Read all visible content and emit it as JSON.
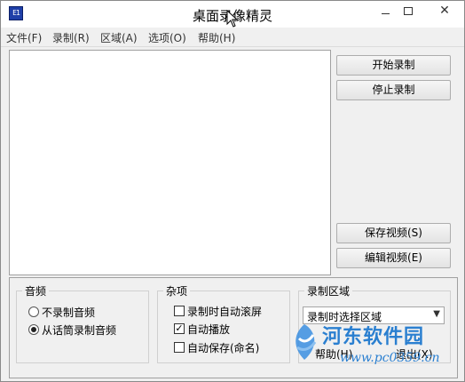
{
  "window": {
    "title": "桌面录像精灵",
    "app_icon_text": "E1"
  },
  "menu": [
    {
      "label": "文件(F)"
    },
    {
      "label": "录制(R)"
    },
    {
      "label": "区域(A)"
    },
    {
      "label": "选项(O)"
    },
    {
      "label": "帮助(H)"
    }
  ],
  "buttons": {
    "start": "开始录制",
    "stop": "停止录制",
    "save": "保存视频(S)",
    "edit": "编辑视频(E)",
    "help": "帮助(H)",
    "exit": "退出(X)"
  },
  "audio": {
    "title": "音频",
    "options": [
      {
        "label": "不录制音频",
        "selected": false
      },
      {
        "label": "从话筒录制音频",
        "selected": true
      }
    ]
  },
  "misc": {
    "title": "杂项",
    "options": [
      {
        "label": "录制时自动滚屏",
        "checked": false
      },
      {
        "label": "自动播放",
        "checked": true
      },
      {
        "label": "自动保存(命名)",
        "checked": false
      }
    ]
  },
  "region": {
    "title": "录制区域",
    "selected": "录制时选择区域"
  },
  "watermark": {
    "name": "河东软件园",
    "url": "www.pc0359.cn"
  },
  "colors": {
    "accent": "#2a7fd0",
    "window_bg": "#f0f0f0"
  }
}
